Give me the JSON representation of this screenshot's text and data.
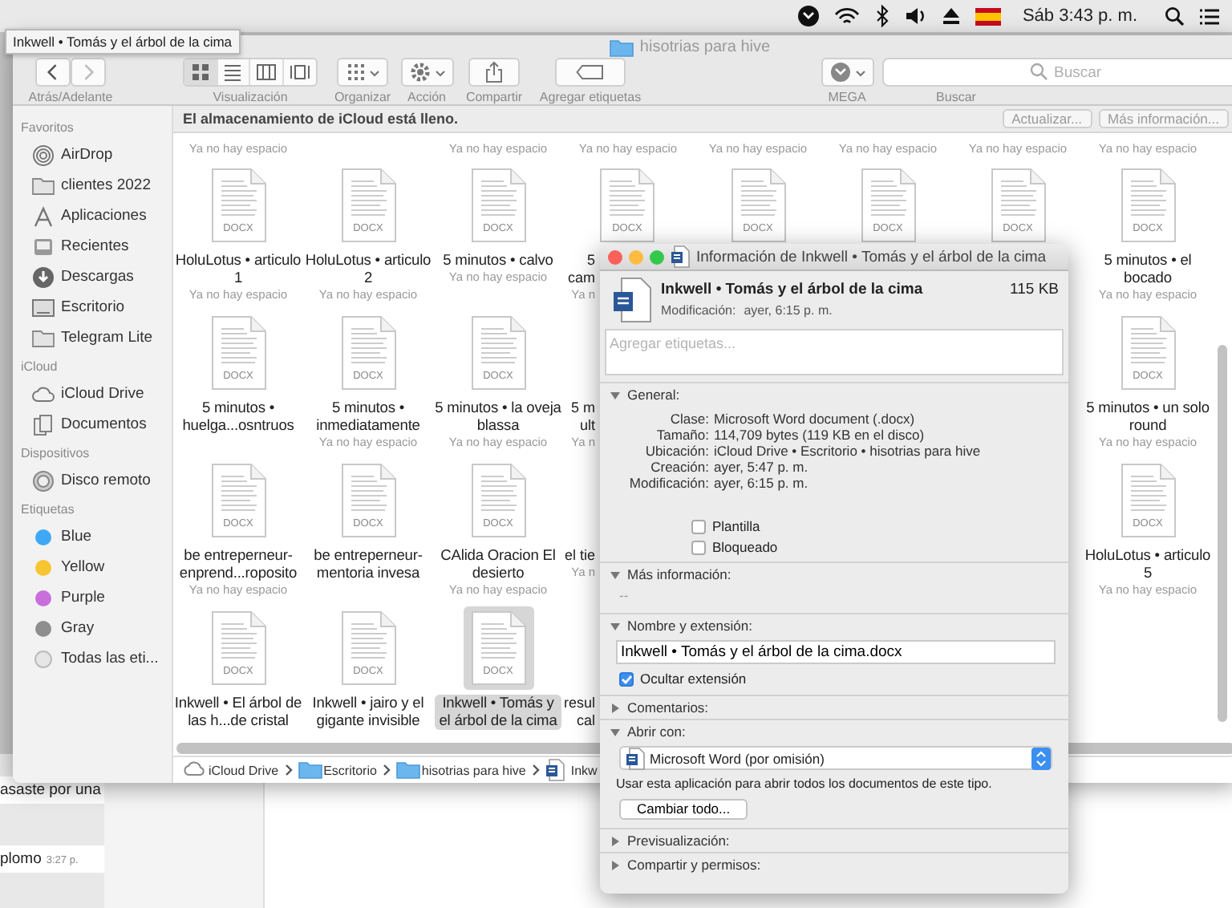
{
  "menubar": {
    "clock": "Sáb 3:43 p. m."
  },
  "tooltip": {
    "text": "Inkwell • Tomás y el árbol de la cima"
  },
  "chat": {
    "messages": [
      {
        "text": "asaste por una"
      },
      {
        "text": "plomo",
        "time": "3:27 p."
      }
    ]
  },
  "finder": {
    "title": "hisotrias para hive",
    "toolbar": [
      {
        "kind": "nav",
        "label": "Atrás/Adelante"
      },
      {
        "kind": "views",
        "label": "Visualización",
        "modes": [
          {
            "kind": "icons",
            "selected": true
          },
          {
            "kind": "list",
            "selected": false
          },
          {
            "kind": "columns",
            "selected": false
          },
          {
            "kind": "gallery",
            "selected": false
          }
        ]
      },
      {
        "kind": "arrange",
        "label": "Organizar"
      },
      {
        "kind": "action",
        "label": "Acción"
      },
      {
        "kind": "share",
        "label": "Compartir"
      },
      {
        "kind": "tags",
        "label": "Agregar etiquetas"
      },
      {
        "kind": "mega",
        "label": "MEGA"
      },
      {
        "kind": "search",
        "label": "Buscar",
        "placeholder": "Buscar"
      }
    ],
    "sidebar": [
      {
        "heading": "Favoritos",
        "items": [
          {
            "kind": "airdrop",
            "label": "AirDrop"
          },
          {
            "kind": "folder",
            "label": "clientes 2022"
          },
          {
            "kind": "apps",
            "label": "Aplicaciones"
          },
          {
            "kind": "recents",
            "label": "Recientes"
          },
          {
            "kind": "downloads",
            "label": "Descargas"
          },
          {
            "kind": "desktop",
            "label": "Escritorio"
          },
          {
            "kind": "folder",
            "label": "Telegram Lite"
          }
        ]
      },
      {
        "heading": "iCloud",
        "items": [
          {
            "kind": "cloud",
            "label": "iCloud Drive"
          },
          {
            "kind": "documents",
            "label": "Documentos"
          }
        ]
      },
      {
        "heading": "Dispositivos",
        "items": [
          {
            "kind": "disk",
            "label": "Disco remoto"
          }
        ]
      },
      {
        "heading": "Etiquetas",
        "items": [
          {
            "kind": "tag",
            "label": "Blue",
            "color": "#3ea8f5"
          },
          {
            "kind": "tag",
            "label": "Yellow",
            "color": "#f7c531"
          },
          {
            "kind": "tag",
            "label": "Purple",
            "color": "#c86fdc"
          },
          {
            "kind": "tag",
            "label": "Gray",
            "color": "#8e8e8e"
          },
          {
            "kind": "all-tags",
            "label": "Todas las eti..."
          }
        ]
      }
    ],
    "banner": {
      "message": "El almacenamiento de iCloud está lleno.",
      "buttons": [
        "Actualizar...",
        "Más información..."
      ]
    },
    "top_row": [
      {
        "kind": "note",
        "note": "Ya no hay espacio"
      },
      {
        "kind": "blank"
      },
      {
        "kind": "note",
        "note": "Ya no hay espacio"
      },
      {
        "kind": "note",
        "note": "Ya no hay espacio"
      },
      {
        "kind": "note",
        "note": "Ya no hay espacio"
      },
      {
        "kind": "note",
        "note": "Ya no hay espacio"
      },
      {
        "kind": "note",
        "note": "Ya no hay espacio"
      },
      {
        "kind": "note",
        "note": "Ya no hay espacio"
      }
    ],
    "rows": [
      {
        "items": [
          {
            "kind": "file",
            "type_label": "DOCX",
            "name": "HoluLotus • articulo 1",
            "note": "Ya no hay espacio",
            "selected": false
          },
          {
            "kind": "file",
            "type_label": "DOCX",
            "name": "HoluLotus • articulo 2",
            "note": "Ya no hay espacio",
            "selected": false
          },
          {
            "kind": "file",
            "type_label": "DOCX",
            "name": "5 minutos • calvo",
            "note": "Ya no hay espacio",
            "selected": false
          },
          {
            "kind": "partial",
            "type_label": "DOCX",
            "lines": [
              "5",
              "cam"
            ],
            "note": "Ya n"
          },
          {
            "kind": "icon-only",
            "type_label": "DOCX"
          },
          {
            "kind": "icon-only",
            "type_label": "DOCX"
          },
          {
            "kind": "icon-only",
            "type_label": "DOCX"
          },
          {
            "kind": "file",
            "type_label": "DOCX",
            "name": "5 minutos • el bocado",
            "note": "Ya no hay espacio",
            "selected": false
          }
        ]
      },
      {
        "items": [
          {
            "kind": "file",
            "type_label": "DOCX",
            "name": "5 minutos • huelga...osntruos",
            "selected": false
          },
          {
            "kind": "file",
            "type_label": "DOCX",
            "name": "5 minutos • inmediatamente",
            "note": "Ya no hay espacio",
            "selected": false
          },
          {
            "kind": "file",
            "type_label": "DOCX",
            "name": "5 minutos • la oveja blassa",
            "note": "Ya no hay espacio",
            "selected": false
          },
          {
            "kind": "partial",
            "lines": [
              "5 m",
              "ult"
            ],
            "note": "Ya n"
          },
          {
            "kind": "file",
            "type_label": "DOCX",
            "name": "5 minutos • un solo round",
            "note": "Ya no hay espacio",
            "selected": false
          }
        ]
      },
      {
        "items": [
          {
            "kind": "file",
            "type_label": "DOCX",
            "name": "be entreperneur- enprend...roposito",
            "note": "Ya no hay espacio",
            "selected": false
          },
          {
            "kind": "file",
            "type_label": "DOCX",
            "name": "be entreperneur- mentoria invesa",
            "selected": false
          },
          {
            "kind": "file",
            "type_label": "DOCX",
            "name": "CAlida Oracion El desierto",
            "note": "Ya no hay espacio",
            "selected": false
          },
          {
            "kind": "partial",
            "lines": [
              "el tie"
            ],
            "note": "Ya n"
          },
          {
            "kind": "file",
            "type_label": "DOCX",
            "name": "HoluLotus • articulo 5",
            "note": "Ya no hay espacio",
            "selected": false
          }
        ]
      },
      {
        "items": [
          {
            "kind": "file",
            "type_label": "DOCX",
            "name": "Inkwell • El árbol de las h...de cristal",
            "selected": false
          },
          {
            "kind": "file",
            "type_label": "DOCX",
            "name": "Inkwell • jairo y el gigante invisible",
            "selected": false
          },
          {
            "kind": "file",
            "type_label": "DOCX",
            "name": "Inkwell • Tomás y el árbol de la cima",
            "selected": true
          },
          {
            "kind": "partial",
            "lines": [
              "resul",
              "cal"
            ]
          }
        ]
      }
    ],
    "path": [
      {
        "kind": "cloud",
        "label": "iCloud Drive"
      },
      {
        "kind": "folder",
        "label": "Escritorio"
      },
      {
        "kind": "folder",
        "label": "hisotrias para hive"
      },
      {
        "kind": "document",
        "label": "Inkw"
      }
    ]
  },
  "info": {
    "title": "Información de Inkwell • Tomás y el árbol de la cima",
    "name": "Inkwell • Tomás y el árbol de la cima",
    "size": "115 KB",
    "modified_label": "Modificación:",
    "modified": "ayer, 6:15 p. m.",
    "tags_placeholder": "Agregar etiquetas...",
    "sections": [
      {
        "kind": "general",
        "title": "General:",
        "expanded": true,
        "fields": [
          {
            "label": "Clase:",
            "value": "Microsoft Word document (.docx)"
          },
          {
            "label": "Tamaño:",
            "value": "114,709 bytes (119 KB en el disco)"
          },
          {
            "label": "Ubicación:",
            "value": "iCloud Drive • Escritorio • hisotrias para hive"
          },
          {
            "label": "Creación:",
            "value": "ayer, 5:47 p. m."
          },
          {
            "label": "Modificación:",
            "value": "ayer, 6:15 p. m."
          }
        ],
        "checkboxes": [
          {
            "label": "Plantilla",
            "checked": false
          },
          {
            "label": "Bloqueado",
            "checked": false
          }
        ]
      },
      {
        "kind": "more",
        "title": "Más información:",
        "expanded": true,
        "text": "--"
      },
      {
        "kind": "name",
        "title": "Nombre y extensión:",
        "expanded": true,
        "value": "Inkwell • Tomás y el árbol de la cima.docx",
        "checkboxes": [
          {
            "label": "Ocultar extensión",
            "checked": true
          }
        ]
      },
      {
        "title": "Comentarios:",
        "expanded": false
      },
      {
        "kind": "open-with",
        "title": "Abrir con:",
        "expanded": true,
        "app": "Microsoft Word (por omisión)",
        "note": "Usar esta aplicación para abrir todos los documentos de este tipo.",
        "button": "Cambiar todo..."
      },
      {
        "title": "Previsualización:",
        "expanded": false
      },
      {
        "title": "Compartir y permisos:",
        "expanded": false
      }
    ]
  }
}
